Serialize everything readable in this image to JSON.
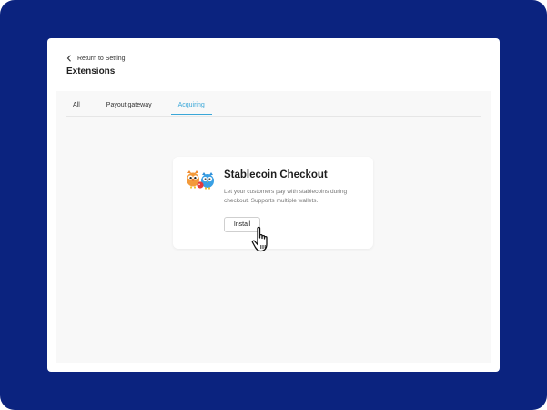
{
  "header": {
    "back_link": "Return to Setting",
    "title": "Extensions"
  },
  "tabs": [
    {
      "label": "All",
      "active": false
    },
    {
      "label": "Payout gateway",
      "active": false
    },
    {
      "label": "Acquiring",
      "active": true
    }
  ],
  "extension_card": {
    "title": "Stablecoin Checkout",
    "description": "Let your customers pay with stablecoins during checkout. Supports multiple wallets.",
    "install_label": "Install",
    "logo_icon": "owl-mascots-icon"
  },
  "colors": {
    "frame_background": "#0b237f",
    "active_tab": "#3aa7d8",
    "content_background": "#f8f8f8"
  }
}
